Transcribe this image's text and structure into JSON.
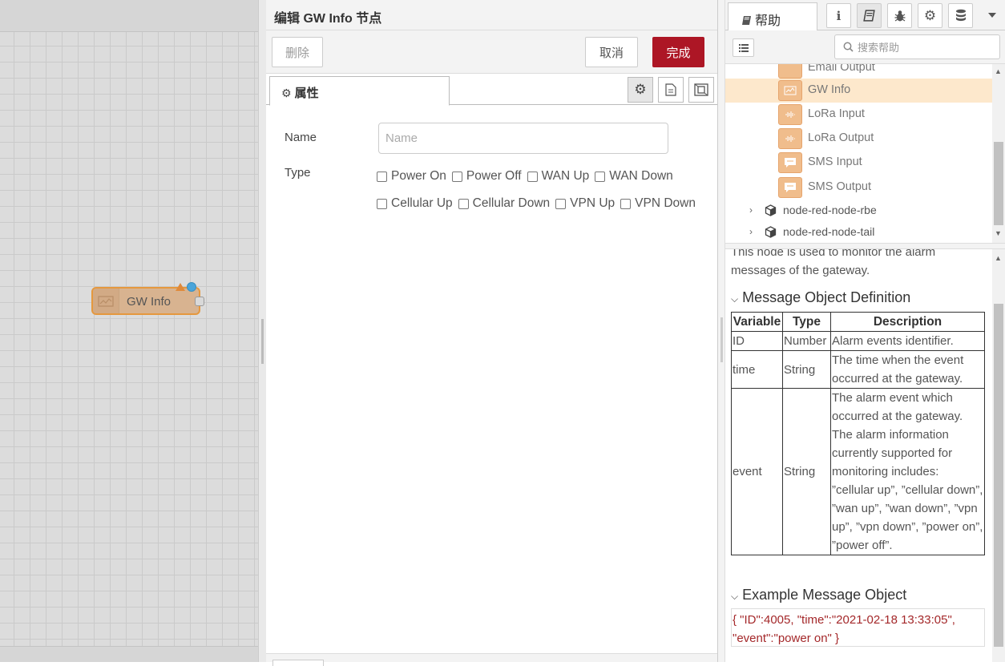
{
  "workspace": {
    "node_label": "GW Info"
  },
  "tray": {
    "title": "编辑 GW Info 节点",
    "delete_label": "删除",
    "cancel_label": "取消",
    "done_label": "完成",
    "tab_properties": "属性",
    "form": {
      "name_label": "Name",
      "name_placeholder": "Name",
      "name_value": "",
      "type_label": "Type",
      "type_row1": [
        "Power On",
        "Power Off",
        "WAN Up",
        "WAN Down"
      ],
      "type_row2": [
        "Cellular Up",
        "Cellular Down",
        "VPN Up",
        "VPN Down"
      ]
    }
  },
  "sidebar": {
    "help_tab_label": "帮助",
    "tab_icons": [
      "info-icon",
      "book-icon",
      "bug-icon",
      "gear-icon",
      "database-icon"
    ],
    "search_placeholder": "搜索帮助",
    "tree": {
      "partial_item": "Email Output",
      "items": [
        {
          "label": "GW Info",
          "selected": true,
          "icon": "chart-icon"
        },
        {
          "label": "LoRa Input",
          "selected": false,
          "icon": "wave-icon"
        },
        {
          "label": "LoRa Output",
          "selected": false,
          "icon": "wave-icon"
        },
        {
          "label": "SMS Input",
          "selected": false,
          "icon": "message-icon"
        },
        {
          "label": "SMS Output",
          "selected": false,
          "icon": "message-icon"
        }
      ],
      "packages": [
        "node-red-node-rbe",
        "node-red-node-tail"
      ]
    },
    "help": {
      "intro_line1": "This node is used to monitor the alarm",
      "intro_line2": "messages of the gateway.",
      "section_definition": "Message Object Definition",
      "table_headers": [
        "Variable",
        "Type",
        "Description"
      ],
      "rows": [
        {
          "variable": "ID",
          "type": "Number",
          "description": "Alarm events identifier."
        },
        {
          "variable": "time",
          "type": "String",
          "description": "The time when the event occurred at the gateway."
        },
        {
          "variable": "event",
          "type": "String",
          "description": "The alarm event which occurred at the gateway. The alarm information currently supported for monitoring includes: ”cellular up”, ”cellular down”, ”wan up”, ”wan down”, ”vpn up”, ”vpn down”, ”power on”, ”power off”."
        }
      ],
      "section_example": "Example Message Object",
      "example": "{ \"ID\":4005, \"time\":\"2021-02-18 13:33:05\", \"event\":\"power on\" }"
    }
  },
  "colors": {
    "accent_red": "#ad1625",
    "node_orange": "#e5983e",
    "selected_bg": "#fde8cc"
  }
}
